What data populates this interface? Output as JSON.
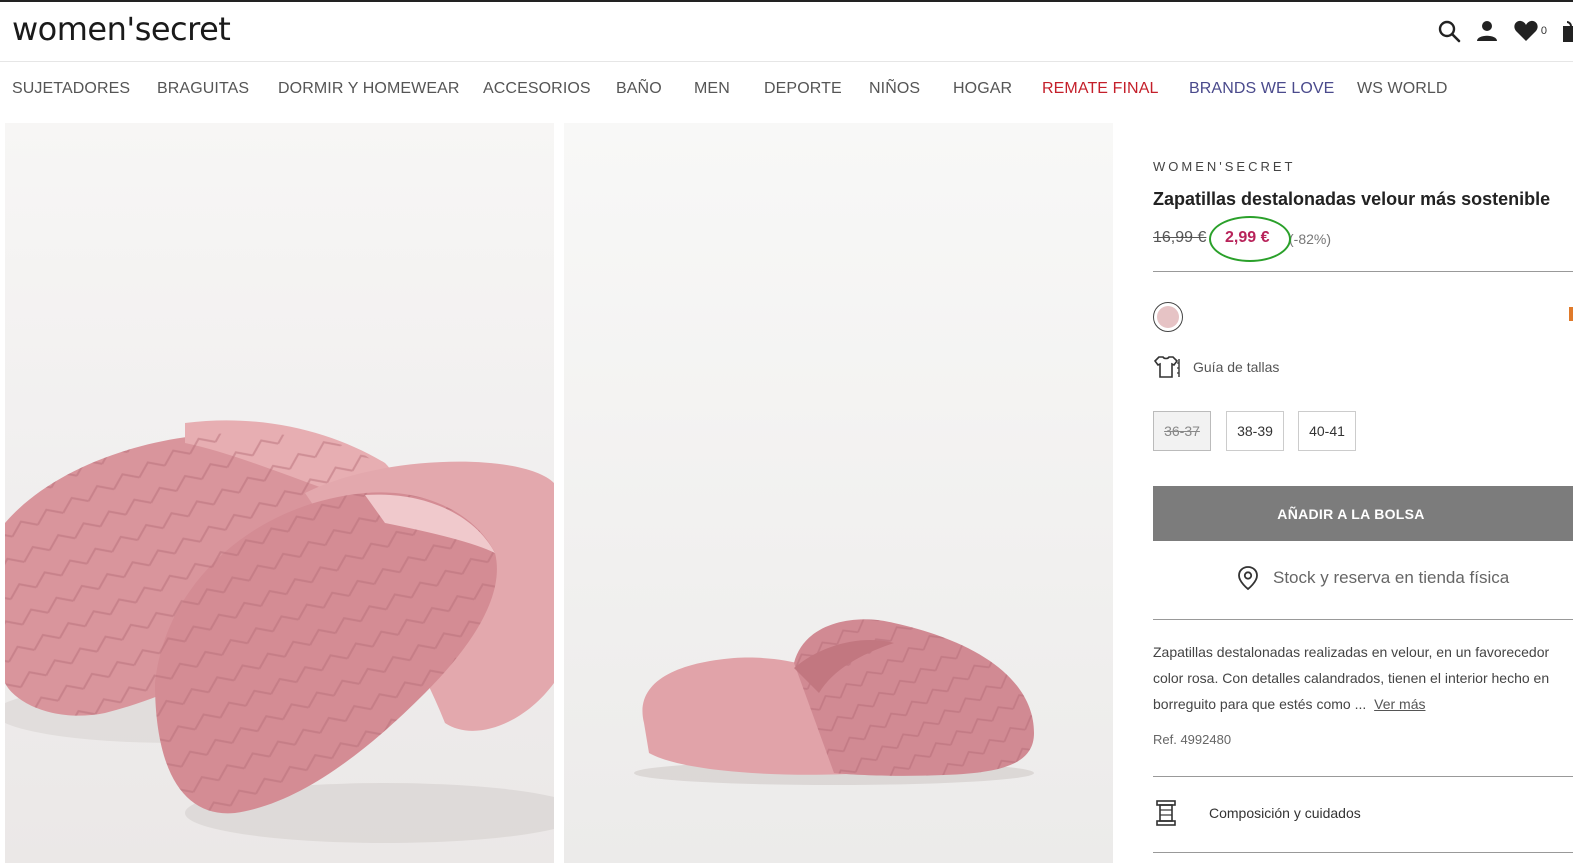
{
  "header": {
    "logo": "women'secret",
    "wishlist_count": "0"
  },
  "nav": {
    "items": [
      {
        "label": "SUJETADORES",
        "color": "#555555"
      },
      {
        "label": "BRAGUITAS",
        "color": "#555555"
      },
      {
        "label": "DORMIR Y HOMEWEAR",
        "color": "#555555"
      },
      {
        "label": "ACCESORIOS",
        "color": "#555555"
      },
      {
        "label": "BAÑO",
        "color": "#555555"
      },
      {
        "label": "MEN",
        "color": "#555555"
      },
      {
        "label": "DEPORTE",
        "color": "#555555"
      },
      {
        "label": "NIÑOS",
        "color": "#555555"
      },
      {
        "label": "HOGAR",
        "color": "#555555"
      },
      {
        "label": "REMATE FINAL",
        "color": "#c41f2a"
      },
      {
        "label": "BRANDS WE LOVE",
        "color": "#4a4a8c"
      },
      {
        "label": "WS WORLD",
        "color": "#555555"
      }
    ]
  },
  "product": {
    "brand": "WOMEN'SECRET",
    "title": "Zapatillas destalonadas velour más sostenible",
    "old_price": "16,99 €",
    "new_price": "2,99 €",
    "discount": "(-82%)",
    "swatch_color": "#e6c3c5",
    "size_guide_label": "Guía de tallas",
    "sizes": [
      {
        "label": "36-37",
        "available": false
      },
      {
        "label": "38-39",
        "available": true
      },
      {
        "label": "40-41",
        "available": true
      }
    ],
    "add_to_bag": "AÑADIR A LA BOLSA",
    "stock_label": "Stock y reserva en tienda física",
    "description_lines": [
      "Zapatillas destalonadas realizadas en velour, en un favorecedor",
      "color rosa. Con detalles calandrados, tienen el interior hecho en",
      "borreguito para que estés como ..."
    ],
    "see_more": "Ver más",
    "ref": "Ref. 4992480",
    "composition_label": "Composición y cuidados"
  },
  "colors": {
    "price_accent": "#b8235a",
    "highlight_circle": "#2aa02a",
    "add_button_bg": "#7c7c7c"
  }
}
